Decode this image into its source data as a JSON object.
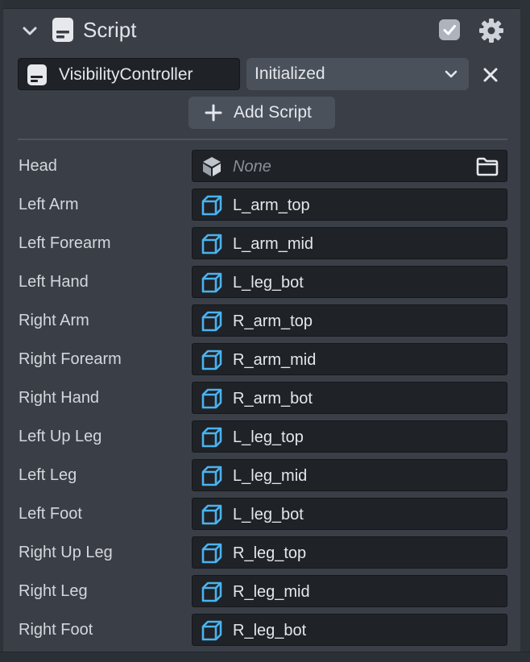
{
  "header": {
    "title": "Script",
    "enabled": true,
    "expand_icon": "chevron-down-icon",
    "settings_icon": "gear-icon"
  },
  "script": {
    "name": "VisibilityController",
    "state": "Initialized",
    "state_options_visible": [
      "Initialized"
    ]
  },
  "add_button": {
    "label": "Add Script"
  },
  "properties": [
    {
      "label": "Head",
      "value": "None",
      "empty": true
    },
    {
      "label": "Left Arm",
      "value": "L_arm_top"
    },
    {
      "label": "Left Forearm",
      "value": "L_arm_mid"
    },
    {
      "label": "Left Hand",
      "value": "L_leg_bot"
    },
    {
      "label": "Right Arm",
      "value": "R_arm_top"
    },
    {
      "label": "Right Forearm",
      "value": "R_arm_mid"
    },
    {
      "label": "Right Hand",
      "value": "R_arm_bot"
    },
    {
      "label": "Left Up Leg",
      "value": "L_leg_top"
    },
    {
      "label": "Left Leg",
      "value": "L_leg_mid"
    },
    {
      "label": "Left Foot",
      "value": "L_leg_bot"
    },
    {
      "label": "Right Up Leg",
      "value": "R_leg_top"
    },
    {
      "label": "Right Leg",
      "value": "R_leg_mid"
    },
    {
      "label": "Right Foot",
      "value": "R_leg_bot"
    }
  ],
  "colors": {
    "panel": "#3a3f47",
    "field": "#1f2227",
    "button": "#4b515a",
    "cube_accent": "#4ab3ef",
    "checkbox": "#aeb4bd"
  }
}
